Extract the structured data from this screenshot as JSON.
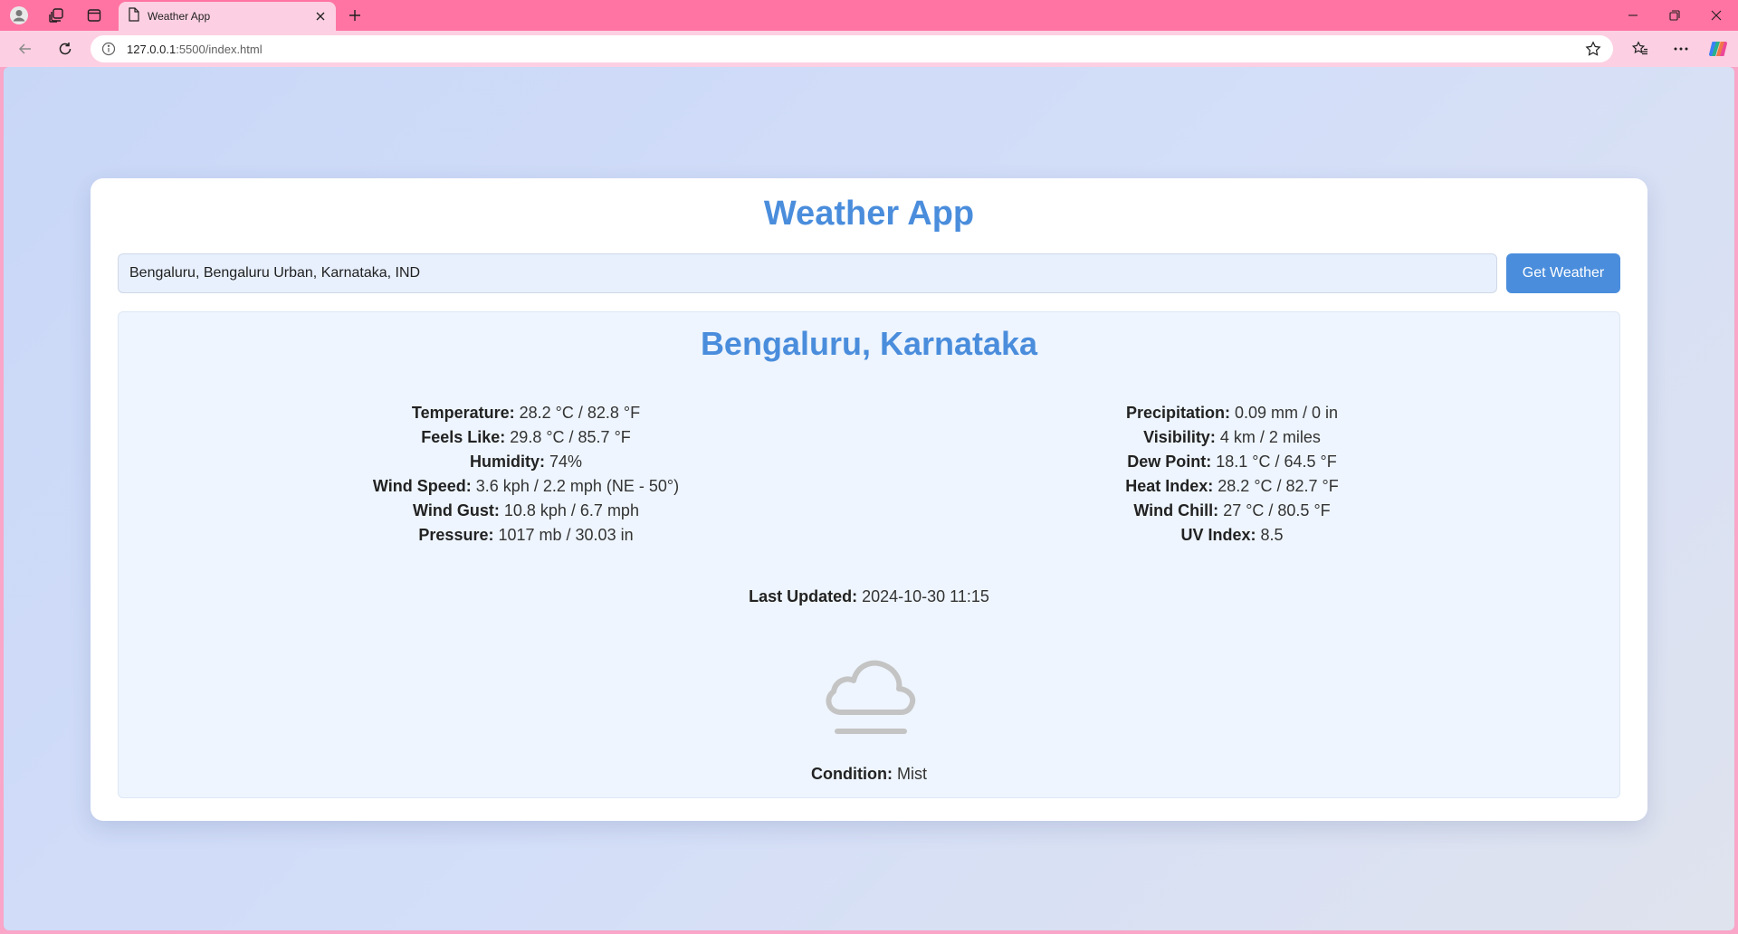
{
  "browser": {
    "tab_title": "Weather App",
    "url_host": "127.0.0.1",
    "url_path": ":5500/index.html"
  },
  "app": {
    "title": "Weather App",
    "search": {
      "value": "Bengaluru, Bengaluru Urban, Karnataka, IND",
      "button_label": "Get Weather"
    },
    "location": "Bengaluru, Karnataka",
    "left": [
      {
        "label": "Temperature:",
        "value": "28.2 °C / 82.8 °F"
      },
      {
        "label": "Feels Like:",
        "value": "29.8 °C / 85.7 °F"
      },
      {
        "label": "Humidity:",
        "value": "74%"
      },
      {
        "label": "Wind Speed:",
        "value": "3.6 kph / 2.2 mph (NE - 50°)"
      },
      {
        "label": "Wind Gust:",
        "value": "10.8 kph / 6.7 mph"
      },
      {
        "label": "Pressure:",
        "value": "1017 mb / 30.03 in"
      }
    ],
    "right": [
      {
        "label": "Precipitation:",
        "value": "0.09 mm / 0 in"
      },
      {
        "label": "Visibility:",
        "value": "4 km / 2 miles"
      },
      {
        "label": "Dew Point:",
        "value": "18.1 °C / 64.5 °F"
      },
      {
        "label": "Heat Index:",
        "value": "28.2 °C / 82.7 °F"
      },
      {
        "label": "Wind Chill:",
        "value": "27 °C / 80.5 °F"
      },
      {
        "label": "UV Index:",
        "value": "8.5"
      }
    ],
    "last_updated": {
      "label": "Last Updated:",
      "value": "2024-10-30 11:15"
    },
    "condition": {
      "label": "Condition:",
      "value": "Mist",
      "icon": "mist-cloud-icon"
    }
  },
  "colors": {
    "accent": "#4a8ddc",
    "tabbar": "#ff74a2",
    "toolbar": "#fcd0e2"
  }
}
